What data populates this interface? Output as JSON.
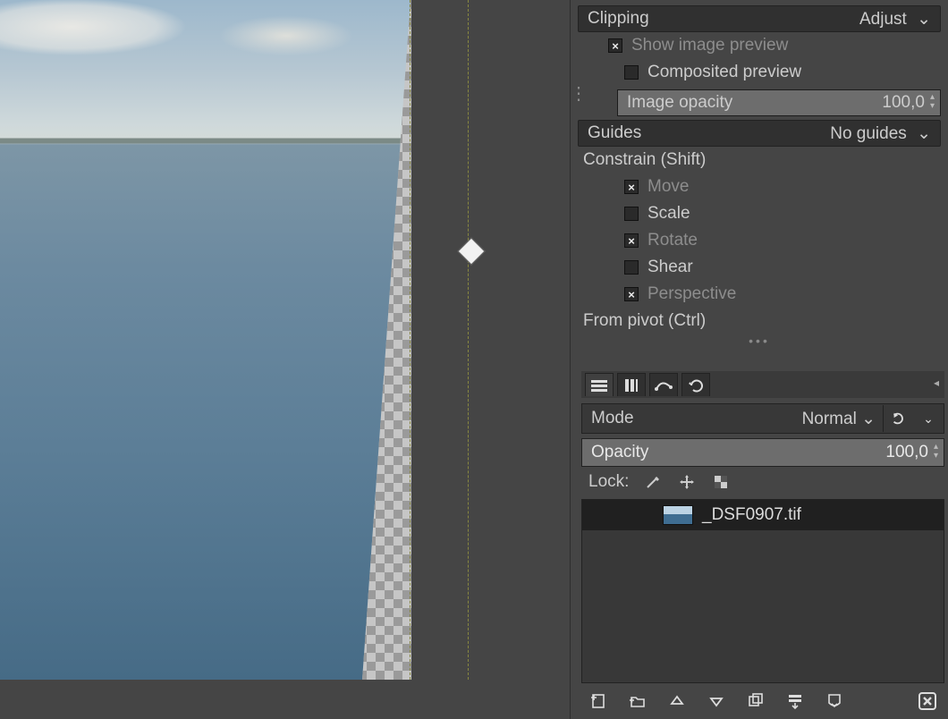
{
  "clipping": {
    "label": "Clipping",
    "value": "Adjust"
  },
  "preview": {
    "show_image_label": "Show image preview",
    "show_image_checked": true,
    "composited_label": "Composited preview",
    "composited_checked": false,
    "opacity_label": "Image opacity",
    "opacity_value": "100,0"
  },
  "guides": {
    "label": "Guides",
    "value": "No guides"
  },
  "constrain": {
    "heading": "Constrain (Shift)",
    "options": [
      {
        "label": "Move",
        "checked": true
      },
      {
        "label": "Scale",
        "checked": false
      },
      {
        "label": "Rotate",
        "checked": true
      },
      {
        "label": "Shear",
        "checked": false
      },
      {
        "label": "Perspective",
        "checked": true
      }
    ]
  },
  "from_pivot": {
    "heading": "From pivot  (Ctrl)"
  },
  "layers": {
    "mode_label": "Mode",
    "mode_value": "Normal",
    "opacity_label": "Opacity",
    "opacity_value": "100,0",
    "lock_label": "Lock:",
    "items": [
      {
        "name": "_DSF0907.tif"
      }
    ]
  }
}
